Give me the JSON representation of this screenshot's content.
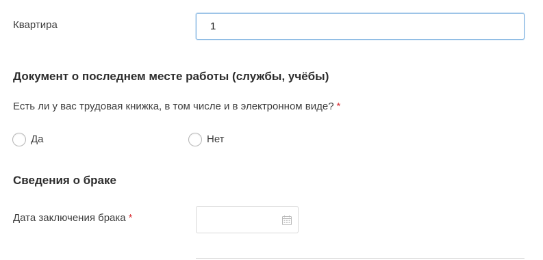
{
  "apartment": {
    "label": "Квартира",
    "value": "1"
  },
  "work_document": {
    "section_title": "Документ о последнем месте работы (службы, учёбы)",
    "question": "Есть ли у вас трудовая книжка, в том числе и в электронном виде?",
    "required_mark": "*",
    "options": [
      {
        "label": "Да",
        "selected": false
      },
      {
        "label": "Нет",
        "selected": false
      }
    ]
  },
  "marriage": {
    "section_title": "Сведения о браке",
    "date_label": "Дата заключения брака",
    "required_mark": "*",
    "date_value": "",
    "calendar_icon": "calendar-icon"
  },
  "colors": {
    "focus_border": "#7fb2e0",
    "required": "#d9343a",
    "text": "#3d3d3d"
  }
}
